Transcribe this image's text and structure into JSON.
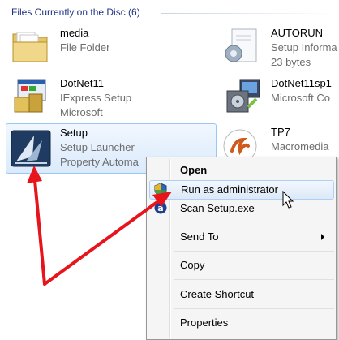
{
  "header": {
    "title": "Files Currently on the Disc (6)"
  },
  "files": [
    {
      "name": "media",
      "line2": "File Folder",
      "line3": "",
      "icon": "folder-icon"
    },
    {
      "name": "AUTORUN",
      "line2": "Setup Informa",
      "line3": "23 bytes",
      "icon": "setup-information-icon"
    },
    {
      "name": "DotNet11",
      "line2": "IExpress Setup",
      "line3": "Microsoft",
      "icon": "iexpress-setup-icon"
    },
    {
      "name": "DotNet11sp1",
      "line2": "Microsoft Co",
      "line3": "",
      "icon": "installer-package-icon"
    },
    {
      "name": "Setup",
      "line2": "Setup Launcher",
      "line3": "Property Automa",
      "icon": "setup-launcher-icon"
    },
    {
      "name": "TP7",
      "line2": "Macromedia",
      "line3": "",
      "icon": "macromedia-icon"
    }
  ],
  "context_menu": {
    "items": [
      {
        "label": "Open",
        "bold": true
      },
      {
        "label": "Run as administrator",
        "icon": "uac-shield-icon",
        "highlighted": true
      },
      {
        "label": "Scan Setup.exe",
        "icon": "antivirus-icon"
      },
      {
        "label": "Send To",
        "submenu": true
      },
      {
        "label": "Copy"
      },
      {
        "label": "Create Shortcut"
      },
      {
        "label": "Properties"
      }
    ]
  },
  "colors": {
    "header_text": "#1e3287",
    "selection_bg": "#dbeafc",
    "selection_border": "#99c9f1",
    "annotation_arrow": "#e8141c"
  }
}
